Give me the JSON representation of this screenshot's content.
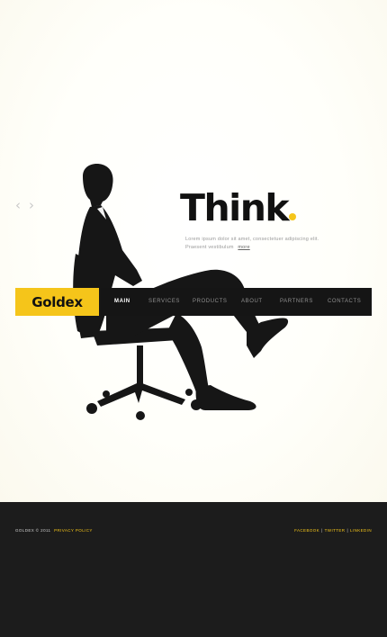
{
  "hero": {
    "headline": "Think",
    "tagline_line1": "Lorem ipsum dolor sit amet, consectetuer adipiscing elit.",
    "tagline_line2": "Praesent vestibulum",
    "more_label": "more"
  },
  "slider": {
    "prev_icon": "‹",
    "next_icon": "›"
  },
  "brand": {
    "logo": "Goldex",
    "accent_color": "#f5c51a"
  },
  "nav": {
    "items": [
      "Main",
      "Services",
      "Products",
      "About",
      "Partners",
      "Contacts"
    ]
  },
  "footer": {
    "copyright": "GOLDEX © 2011",
    "privacy": "PRIVACY POLICY",
    "social": [
      "FACEBOOK",
      "TWITTER",
      "LINKEDIN"
    ],
    "separator": "|"
  }
}
